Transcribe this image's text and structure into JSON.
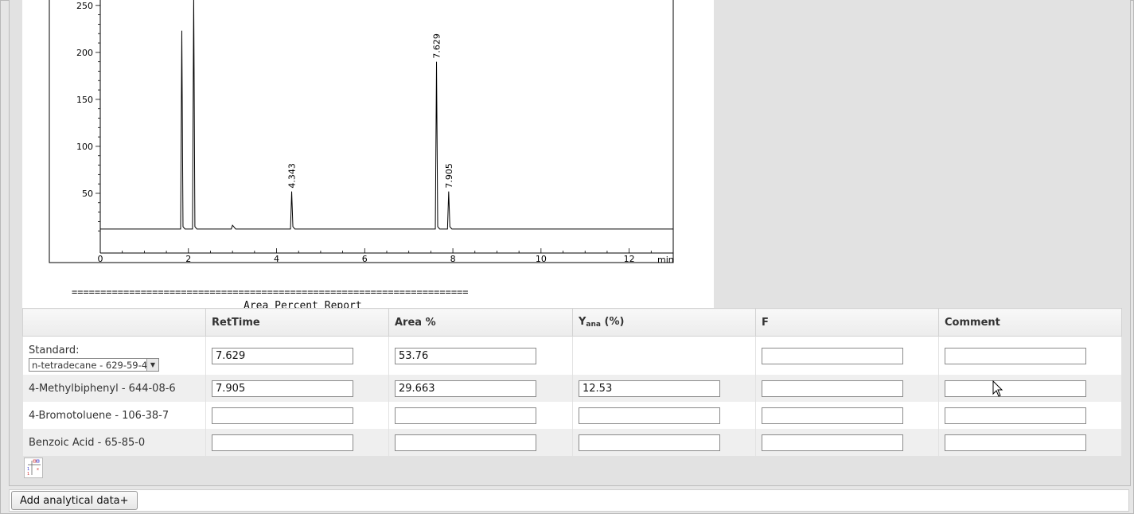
{
  "chart_data": {
    "type": "line",
    "xlabel": "min",
    "ylabel": "",
    "xlim": [
      0,
      13
    ],
    "ylim": [
      0,
      260
    ],
    "x_ticks": [
      0,
      2,
      4,
      6,
      8,
      10,
      12
    ],
    "y_ticks": [
      50,
      100,
      150,
      200,
      250
    ],
    "baseline": 12,
    "peaks": [
      {
        "x": 1.85,
        "y": 223,
        "label": ""
      },
      {
        "x": 2.12,
        "y": 260,
        "label": ""
      },
      {
        "x": 3.0,
        "y": 16,
        "label": ""
      },
      {
        "x": 4.343,
        "y": 52,
        "label": "4.343"
      },
      {
        "x": 7.629,
        "y": 190,
        "label": "7.629"
      },
      {
        "x": 7.905,
        "y": 52,
        "label": "7.905"
      }
    ],
    "partial_top_tick_label": "250"
  },
  "report": {
    "separator": "=====================================================================",
    "title": "Area Percent Report"
  },
  "table": {
    "headers": {
      "col1": "",
      "col2": "RetTime",
      "col3": "Area %",
      "col4_main": "Y",
      "col4_sub": "ana",
      "col4_unit": " (%)",
      "col5": "F",
      "col6": "Comment"
    },
    "standard": {
      "label": "Standard:",
      "selected": "n-tetradecane - 629-59-4",
      "rettime": "7.629",
      "area": "53.76",
      "f": "",
      "comment": ""
    },
    "rows": [
      {
        "compound": "4-Methylbiphenyl - 644-08-6",
        "rettime": "7.905",
        "area": "29.663",
        "yana": "12.53",
        "f": "",
        "comment": ""
      },
      {
        "compound": "4-Bromotoluene - 106-38-7",
        "rettime": "",
        "area": "",
        "yana": "",
        "f": "",
        "comment": ""
      },
      {
        "compound": "Benzoic Acid - 65-85-0",
        "rettime": "",
        "area": "",
        "yana": "",
        "f": "",
        "comment": ""
      }
    ]
  },
  "buttons": {
    "add_analytical": "Add analytical data+"
  },
  "icons": {
    "table_icon": "table-grid-icon",
    "cursor": "mouse-pointer-icon"
  }
}
